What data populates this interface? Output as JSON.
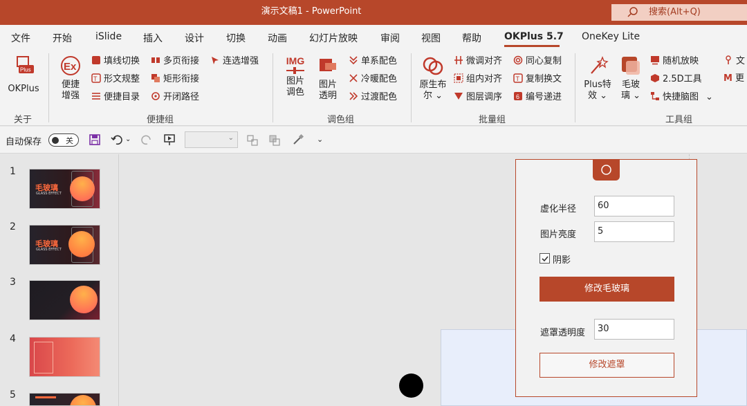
{
  "titlebar": {
    "title": "演示文稿1  -  PowerPoint",
    "search": "搜索(Alt+Q)"
  },
  "tabs": [
    "文件",
    "开始",
    "iSlide",
    "插入",
    "设计",
    "切换",
    "动画",
    "幻灯片放映",
    "审阅",
    "视图",
    "帮助",
    "OKPlus 5.7",
    "OneKey Lite"
  ],
  "ribbon": {
    "okplus": "OKPlus",
    "group_about": "关于",
    "bianjie": [
      "便捷",
      "增强"
    ],
    "col1": [
      "填线切换",
      "形文规整",
      "便捷目录"
    ],
    "col2": [
      "多页衔接",
      "矩形衔接",
      "开闭路径"
    ],
    "col3": "连选增强",
    "group_bianjie": "便捷组",
    "img_label": "IMG",
    "tupian_tiaose": [
      "图片",
      "调色"
    ],
    "tupian_touming": [
      "图片",
      "透明"
    ],
    "col4": [
      "单系配色",
      "冷暖配色",
      "过渡配色"
    ],
    "group_tiaose": "调色组",
    "yuanshengbuer": [
      "原生布",
      "尔 ⌄"
    ],
    "col5": [
      "微调对齐",
      "组内对齐",
      "图层调序"
    ],
    "col6": [
      "同心复制",
      "复制换文",
      "编号递进"
    ],
    "group_piliang": "批量组",
    "plus_texiao": [
      "Plus特",
      "效 ⌄"
    ],
    "maoboli": [
      "毛玻",
      "璃 ⌄"
    ],
    "col7": [
      "随机放映",
      "2.5D工具",
      "快捷脑图"
    ],
    "col8": [
      "文",
      "更"
    ],
    "group_gongju": "工具组"
  },
  "qat": {
    "autosave": "自动保存",
    "toggle": "关"
  },
  "slides": [
    "1",
    "2",
    "3",
    "4",
    "5"
  ],
  "thumb_text": {
    "title": "毛玻璃",
    "sub": "GLASS EFFECT"
  },
  "panel": {
    "blur_label": "虚化半径",
    "blur_value": "60",
    "bright_label": "图片亮度",
    "bright_value": "5",
    "shadow_label": "阴影",
    "modify_glass": "修改毛玻璃",
    "mask_label": "遮罩透明度",
    "mask_value": "30",
    "modify_mask": "修改遮罩"
  },
  "colors": {
    "accent": "#b7472a",
    "ribbon_bg": "#f3f3f3",
    "canvas_bg": "#e6e6e6"
  }
}
